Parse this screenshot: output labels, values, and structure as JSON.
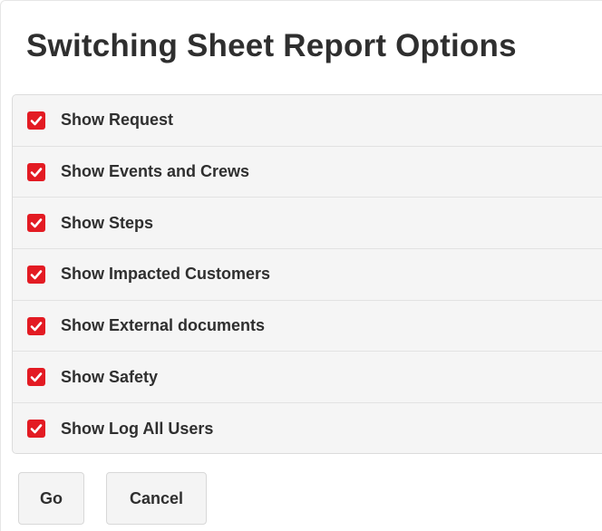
{
  "dialog": {
    "title": "Switching Sheet Report Options"
  },
  "options": [
    {
      "label": "Show Request",
      "checked": true
    },
    {
      "label": "Show Events and Crews",
      "checked": true
    },
    {
      "label": "Show Steps",
      "checked": true
    },
    {
      "label": "Show Impacted Customers",
      "checked": true
    },
    {
      "label": "Show External documents",
      "checked": true
    },
    {
      "label": "Show Safety",
      "checked": true
    },
    {
      "label": "Show Log All Users",
      "checked": true
    }
  ],
  "buttons": {
    "go_label": "Go",
    "cancel_label": "Cancel"
  },
  "colors": {
    "checkbox_checked": "#e31b23",
    "text": "#2f2f2f",
    "panel_bg": "#f5f5f5"
  },
  "icons": {
    "checkbox": "checkmark-icon"
  }
}
